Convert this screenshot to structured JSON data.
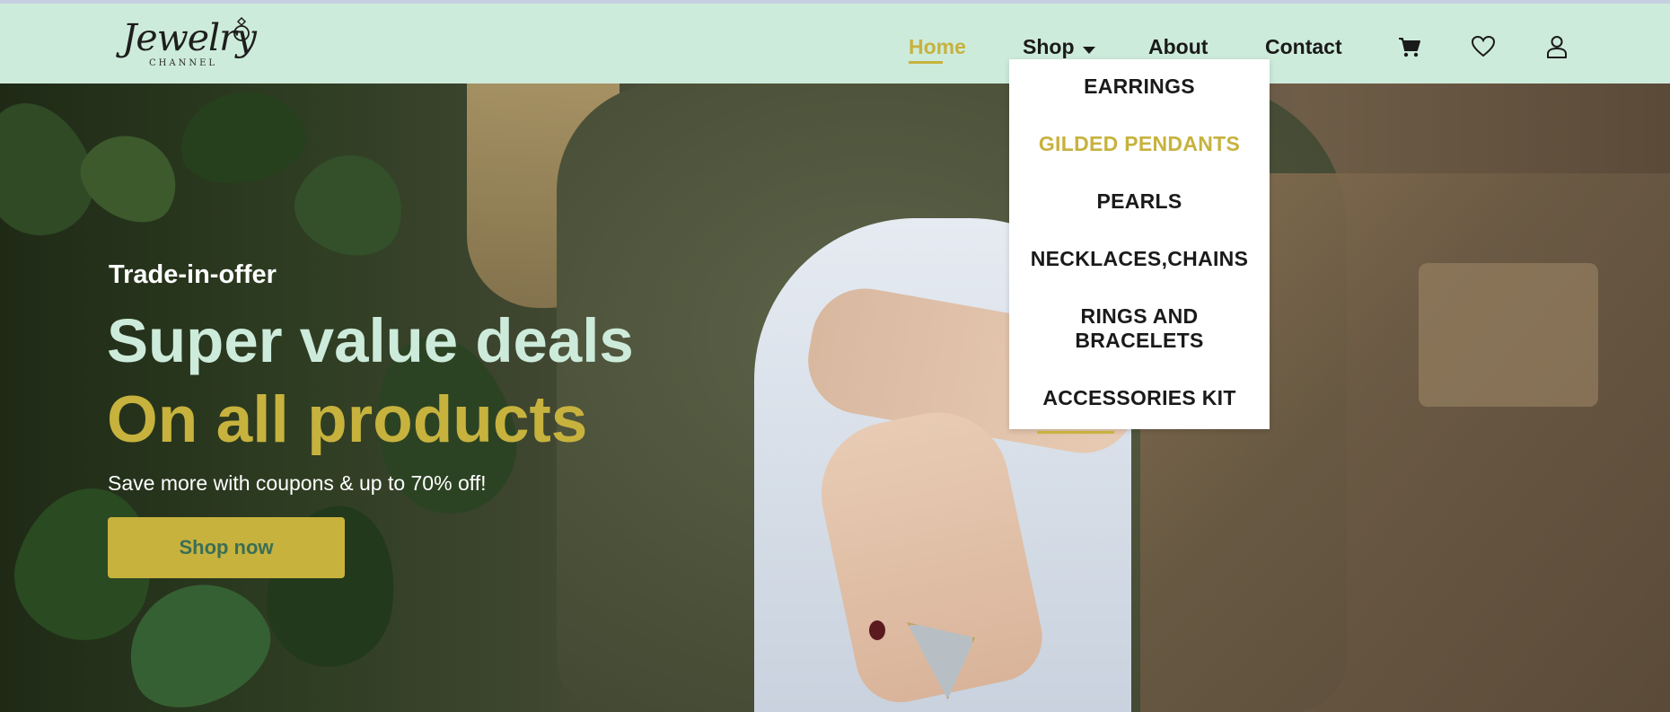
{
  "brand": {
    "logo_text": "Jewelry",
    "logo_subtext": "CHANNEL"
  },
  "nav": {
    "home": "Home",
    "shop": "Shop",
    "about": "About",
    "contact": "Contact",
    "icons": [
      "cart-icon",
      "heart-icon",
      "user-icon"
    ]
  },
  "shop_menu": {
    "items": [
      "EARRINGS",
      "GILDED PENDANTS",
      "PEARLS",
      "NECKLACES,CHAINS",
      "RINGS AND\nBRACELETS",
      "ACCESSORIES KIT"
    ]
  },
  "hero": {
    "subtitle": "Trade-in-offer",
    "title_line1": "Super value deals",
    "title_line2": "On all products",
    "text": "Save more with coupons & up to 70% off!",
    "button": "Shop now"
  },
  "colors": {
    "navbar_bg": "#cdebdb",
    "accent_gold": "#c7b23e",
    "mint_text": "#cdebdb",
    "button_text": "#3b6e55"
  }
}
